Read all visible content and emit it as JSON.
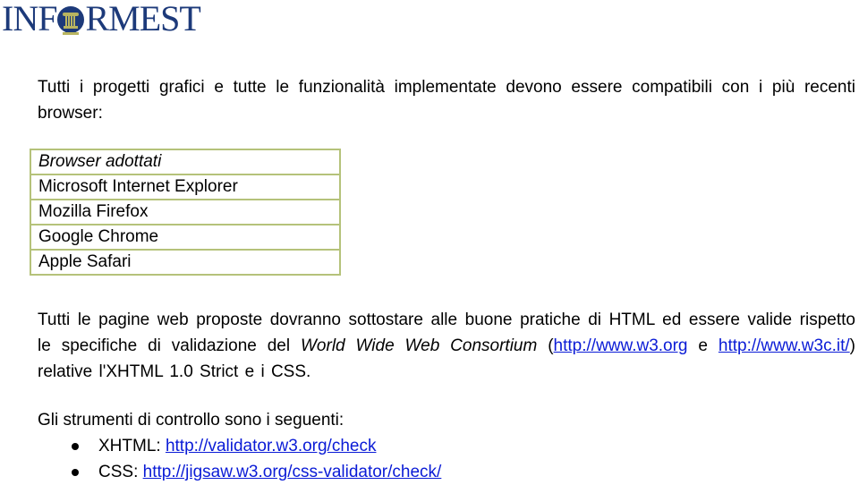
{
  "logo": {
    "text_before": "INF",
    "text_after": "RMEST",
    "brand_color": "#1d3a7a",
    "accent_color": "#b9b560",
    "emblem_icon": "column-icon"
  },
  "intro": {
    "text": "Tutti i progetti grafici e tutte le funzionalità implementate devono essere compatibili con i più recenti browser:"
  },
  "browser_table": {
    "header": "Browser adottati",
    "rows": [
      "Microsoft Internet Explorer",
      "Mozilla Firefox",
      "Google Chrome",
      "Apple Safari"
    ],
    "border_color": "#b5c27a"
  },
  "validation": {
    "text_1": "Tutti le pagine web proposte dovranno sottostare alle buone pratiche di HTML ed essere valide rispetto le specifiche di validazione del ",
    "org_name": "World Wide Web Consortium",
    "text_2": " (",
    "link_1": "http://www.w3.org",
    "text_3": " e ",
    "link_2": "http://www.w3c.it/",
    "text_4": ") relative l'XHTML 1.0 Strict e i CSS."
  },
  "tools": {
    "heading": "Gli strumenti di controllo sono i seguenti:",
    "items": [
      {
        "label": "XHTML: ",
        "link": "http://validator.w3.org/check"
      },
      {
        "label": "CSS: ",
        "link": "http://jigsaw.w3.org/css-validator/check/"
      }
    ]
  },
  "colors": {
    "link": "#0a1bd6"
  }
}
